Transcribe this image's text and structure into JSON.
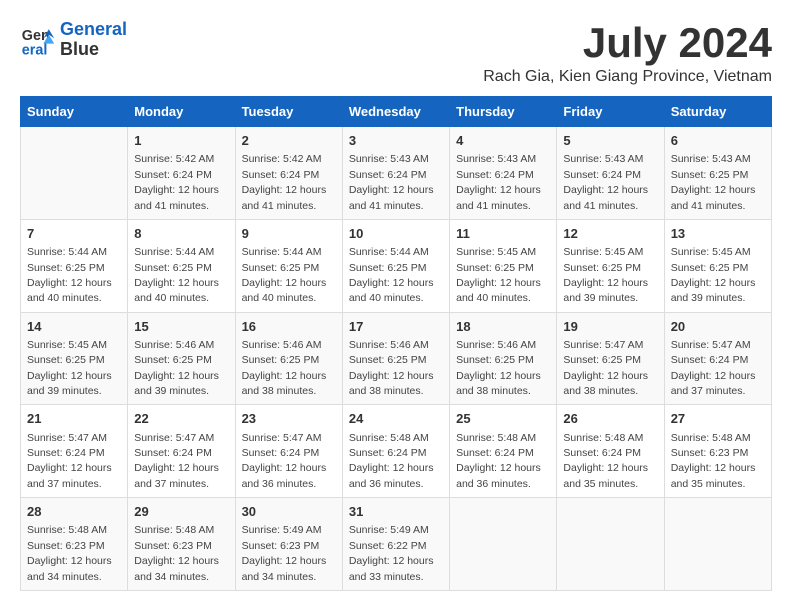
{
  "logo": {
    "line1": "General",
    "line2": "Blue"
  },
  "title": "July 2024",
  "subtitle": "Rach Gia, Kien Giang Province, Vietnam",
  "weekdays": [
    "Sunday",
    "Monday",
    "Tuesday",
    "Wednesday",
    "Thursday",
    "Friday",
    "Saturday"
  ],
  "weeks": [
    [
      {
        "day": "",
        "sunrise": "",
        "sunset": "",
        "daylight": ""
      },
      {
        "day": "1",
        "sunrise": "Sunrise: 5:42 AM",
        "sunset": "Sunset: 6:24 PM",
        "daylight": "Daylight: 12 hours and 41 minutes."
      },
      {
        "day": "2",
        "sunrise": "Sunrise: 5:42 AM",
        "sunset": "Sunset: 6:24 PM",
        "daylight": "Daylight: 12 hours and 41 minutes."
      },
      {
        "day": "3",
        "sunrise": "Sunrise: 5:43 AM",
        "sunset": "Sunset: 6:24 PM",
        "daylight": "Daylight: 12 hours and 41 minutes."
      },
      {
        "day": "4",
        "sunrise": "Sunrise: 5:43 AM",
        "sunset": "Sunset: 6:24 PM",
        "daylight": "Daylight: 12 hours and 41 minutes."
      },
      {
        "day": "5",
        "sunrise": "Sunrise: 5:43 AM",
        "sunset": "Sunset: 6:24 PM",
        "daylight": "Daylight: 12 hours and 41 minutes."
      },
      {
        "day": "6",
        "sunrise": "Sunrise: 5:43 AM",
        "sunset": "Sunset: 6:25 PM",
        "daylight": "Daylight: 12 hours and 41 minutes."
      }
    ],
    [
      {
        "day": "7",
        "sunrise": "Sunrise: 5:44 AM",
        "sunset": "Sunset: 6:25 PM",
        "daylight": "Daylight: 12 hours and 40 minutes."
      },
      {
        "day": "8",
        "sunrise": "Sunrise: 5:44 AM",
        "sunset": "Sunset: 6:25 PM",
        "daylight": "Daylight: 12 hours and 40 minutes."
      },
      {
        "day": "9",
        "sunrise": "Sunrise: 5:44 AM",
        "sunset": "Sunset: 6:25 PM",
        "daylight": "Daylight: 12 hours and 40 minutes."
      },
      {
        "day": "10",
        "sunrise": "Sunrise: 5:44 AM",
        "sunset": "Sunset: 6:25 PM",
        "daylight": "Daylight: 12 hours and 40 minutes."
      },
      {
        "day": "11",
        "sunrise": "Sunrise: 5:45 AM",
        "sunset": "Sunset: 6:25 PM",
        "daylight": "Daylight: 12 hours and 40 minutes."
      },
      {
        "day": "12",
        "sunrise": "Sunrise: 5:45 AM",
        "sunset": "Sunset: 6:25 PM",
        "daylight": "Daylight: 12 hours and 39 minutes."
      },
      {
        "day": "13",
        "sunrise": "Sunrise: 5:45 AM",
        "sunset": "Sunset: 6:25 PM",
        "daylight": "Daylight: 12 hours and 39 minutes."
      }
    ],
    [
      {
        "day": "14",
        "sunrise": "Sunrise: 5:45 AM",
        "sunset": "Sunset: 6:25 PM",
        "daylight": "Daylight: 12 hours and 39 minutes."
      },
      {
        "day": "15",
        "sunrise": "Sunrise: 5:46 AM",
        "sunset": "Sunset: 6:25 PM",
        "daylight": "Daylight: 12 hours and 39 minutes."
      },
      {
        "day": "16",
        "sunrise": "Sunrise: 5:46 AM",
        "sunset": "Sunset: 6:25 PM",
        "daylight": "Daylight: 12 hours and 38 minutes."
      },
      {
        "day": "17",
        "sunrise": "Sunrise: 5:46 AM",
        "sunset": "Sunset: 6:25 PM",
        "daylight": "Daylight: 12 hours and 38 minutes."
      },
      {
        "day": "18",
        "sunrise": "Sunrise: 5:46 AM",
        "sunset": "Sunset: 6:25 PM",
        "daylight": "Daylight: 12 hours and 38 minutes."
      },
      {
        "day": "19",
        "sunrise": "Sunrise: 5:47 AM",
        "sunset": "Sunset: 6:25 PM",
        "daylight": "Daylight: 12 hours and 38 minutes."
      },
      {
        "day": "20",
        "sunrise": "Sunrise: 5:47 AM",
        "sunset": "Sunset: 6:24 PM",
        "daylight": "Daylight: 12 hours and 37 minutes."
      }
    ],
    [
      {
        "day": "21",
        "sunrise": "Sunrise: 5:47 AM",
        "sunset": "Sunset: 6:24 PM",
        "daylight": "Daylight: 12 hours and 37 minutes."
      },
      {
        "day": "22",
        "sunrise": "Sunrise: 5:47 AM",
        "sunset": "Sunset: 6:24 PM",
        "daylight": "Daylight: 12 hours and 37 minutes."
      },
      {
        "day": "23",
        "sunrise": "Sunrise: 5:47 AM",
        "sunset": "Sunset: 6:24 PM",
        "daylight": "Daylight: 12 hours and 36 minutes."
      },
      {
        "day": "24",
        "sunrise": "Sunrise: 5:48 AM",
        "sunset": "Sunset: 6:24 PM",
        "daylight": "Daylight: 12 hours and 36 minutes."
      },
      {
        "day": "25",
        "sunrise": "Sunrise: 5:48 AM",
        "sunset": "Sunset: 6:24 PM",
        "daylight": "Daylight: 12 hours and 36 minutes."
      },
      {
        "day": "26",
        "sunrise": "Sunrise: 5:48 AM",
        "sunset": "Sunset: 6:24 PM",
        "daylight": "Daylight: 12 hours and 35 minutes."
      },
      {
        "day": "27",
        "sunrise": "Sunrise: 5:48 AM",
        "sunset": "Sunset: 6:23 PM",
        "daylight": "Daylight: 12 hours and 35 minutes."
      }
    ],
    [
      {
        "day": "28",
        "sunrise": "Sunrise: 5:48 AM",
        "sunset": "Sunset: 6:23 PM",
        "daylight": "Daylight: 12 hours and 34 minutes."
      },
      {
        "day": "29",
        "sunrise": "Sunrise: 5:48 AM",
        "sunset": "Sunset: 6:23 PM",
        "daylight": "Daylight: 12 hours and 34 minutes."
      },
      {
        "day": "30",
        "sunrise": "Sunrise: 5:49 AM",
        "sunset": "Sunset: 6:23 PM",
        "daylight": "Daylight: 12 hours and 34 minutes."
      },
      {
        "day": "31",
        "sunrise": "Sunrise: 5:49 AM",
        "sunset": "Sunset: 6:22 PM",
        "daylight": "Daylight: 12 hours and 33 minutes."
      },
      {
        "day": "",
        "sunrise": "",
        "sunset": "",
        "daylight": ""
      },
      {
        "day": "",
        "sunrise": "",
        "sunset": "",
        "daylight": ""
      },
      {
        "day": "",
        "sunrise": "",
        "sunset": "",
        "daylight": ""
      }
    ]
  ]
}
